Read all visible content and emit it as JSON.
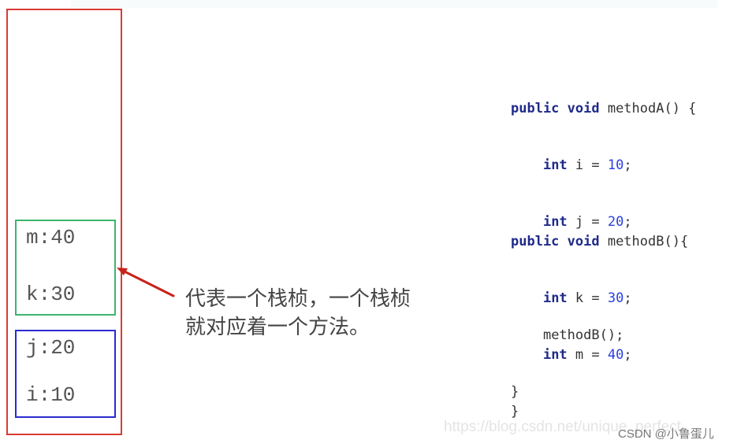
{
  "colors": {
    "stack_border": "#d93a34",
    "frame_methodB_border": "#3db56e",
    "frame_methodA_border": "#2b2bd0",
    "arrow": "#c8221a",
    "keyword": "#1f2a8a",
    "number": "#2a3ee0"
  },
  "stack": {
    "frames": [
      {
        "method": "methodB",
        "vars": [
          "m:40",
          "k:30"
        ]
      },
      {
        "method": "methodA",
        "vars": [
          "j:20",
          "i:10"
        ]
      }
    ]
  },
  "caption": {
    "line1": "代表一个栈桢，一个栈桢",
    "line2": "就对应着一个方法。"
  },
  "code": {
    "methodA": {
      "kw": "public void",
      "sig": " methodA() {",
      "stmts": [
        {
          "kw": "int",
          "rest": " i = ",
          "num": "10",
          "end": ";"
        },
        {
          "kw": "int",
          "rest": " j = ",
          "num": "20",
          "end": ";"
        }
      ],
      "call": "methodB();",
      "close": "}"
    },
    "methodB": {
      "kw": "public void",
      "sig": " methodB(){",
      "stmts": [
        {
          "kw": "int",
          "rest": " k = ",
          "num": "30",
          "end": ";"
        },
        {
          "kw": "int",
          "rest": " m = ",
          "num": "40",
          "end": ";"
        }
      ],
      "close": "}"
    }
  },
  "watermark": {
    "url": "https://blog.csdn.net/unique_perfect",
    "credit": "CSDN @小鲁蛋儿"
  }
}
